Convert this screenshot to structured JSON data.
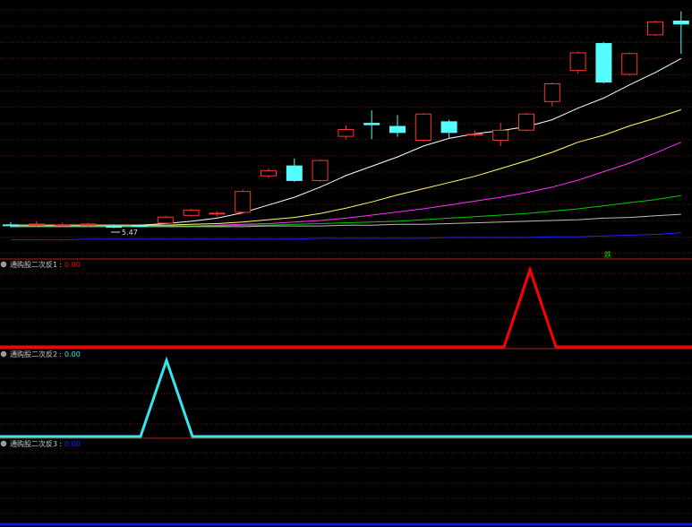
{
  "chart_data": [
    {
      "type": "candlestick",
      "panel": "main",
      "price_label": "5.47",
      "marker_text": "跌",
      "candles": [
        {
          "o": 5.47,
          "c": 5.45,
          "h": 5.5,
          "l": 5.43
        },
        {
          "o": 5.46,
          "c": 5.48,
          "h": 5.51,
          "l": 5.44
        },
        {
          "o": 5.46,
          "c": 5.47,
          "h": 5.49,
          "l": 5.44
        },
        {
          "o": 5.46,
          "c": 5.48,
          "h": 5.49,
          "l": 5.44
        },
        {
          "o": 5.45,
          "c": 5.44,
          "h": 5.47,
          "l": 5.42
        },
        {
          "o": 5.46,
          "c": 5.45,
          "h": 5.47,
          "l": 5.43
        },
        {
          "o": 5.48,
          "c": 5.57,
          "h": 5.58,
          "l": 5.46
        },
        {
          "o": 5.58,
          "c": 5.66,
          "h": 5.67,
          "l": 5.57
        },
        {
          "o": 5.6,
          "c": 5.62,
          "h": 5.64,
          "l": 5.57
        },
        {
          "o": 5.62,
          "c": 5.9,
          "h": 5.92,
          "l": 5.61
        },
        {
          "o": 6.09,
          "c": 6.17,
          "h": 6.19,
          "l": 6.07
        },
        {
          "o": 6.23,
          "c": 6.03,
          "h": 6.32,
          "l": 6.02
        },
        {
          "o": 6.03,
          "c": 6.3,
          "h": 6.31,
          "l": 6.02
        },
        {
          "o": 6.6,
          "c": 6.7,
          "h": 6.75,
          "l": 6.57
        },
        {
          "o": 6.78,
          "c": 6.75,
          "h": 6.94,
          "l": 6.57
        },
        {
          "o": 6.74,
          "c": 6.65,
          "h": 6.88,
          "l": 6.6
        },
        {
          "o": 6.55,
          "c": 6.9,
          "h": 6.91,
          "l": 6.54
        },
        {
          "o": 6.8,
          "c": 6.65,
          "h": 6.82,
          "l": 6.58
        },
        {
          "o": 6.63,
          "c": 6.64,
          "h": 6.68,
          "l": 6.6
        },
        {
          "o": 6.55,
          "c": 6.69,
          "h": 6.78,
          "l": 6.48
        },
        {
          "o": 6.68,
          "c": 6.9,
          "h": 6.91,
          "l": 6.67
        },
        {
          "o": 7.05,
          "c": 7.29,
          "h": 7.3,
          "l": 6.99
        },
        {
          "o": 7.45,
          "c": 7.69,
          "h": 7.7,
          "l": 7.42
        },
        {
          "o": 7.81,
          "c": 7.3,
          "h": 7.82,
          "l": 7.29
        },
        {
          "o": 7.4,
          "c": 7.68,
          "h": 7.69,
          "l": 7.39
        },
        {
          "o": 7.91,
          "c": 8.09,
          "h": 8.1,
          "l": 7.9
        },
        {
          "o": 8.1,
          "c": 8.05,
          "h": 8.22,
          "l": 7.67
        }
      ],
      "moving_averages": [
        {
          "color": "#ffffff",
          "values": [
            5.46,
            5.46,
            5.46,
            5.46,
            5.46,
            5.46,
            5.48,
            5.51,
            5.55,
            5.62,
            5.72,
            5.82,
            5.95,
            6.1,
            6.22,
            6.34,
            6.48,
            6.58,
            6.64,
            6.68,
            6.73,
            6.82,
            6.97,
            7.1,
            7.27,
            7.43,
            7.61
          ]
        },
        {
          "color": "#ffff66",
          "values": [
            5.46,
            5.46,
            5.46,
            5.46,
            5.46,
            5.46,
            5.46,
            5.47,
            5.48,
            5.5,
            5.53,
            5.56,
            5.61,
            5.68,
            5.76,
            5.85,
            5.93,
            6.01,
            6.09,
            6.19,
            6.29,
            6.4,
            6.53,
            6.62,
            6.74,
            6.84,
            6.95
          ]
        },
        {
          "color": "#ff33ff",
          "values": [
            5.45,
            5.45,
            5.45,
            5.45,
            5.45,
            5.45,
            5.45,
            5.45,
            5.46,
            5.47,
            5.48,
            5.5,
            5.52,
            5.55,
            5.59,
            5.63,
            5.67,
            5.72,
            5.77,
            5.82,
            5.88,
            5.95,
            6.04,
            6.15,
            6.26,
            6.39,
            6.53
          ]
        },
        {
          "color": "#00cc00",
          "values": [
            5.45,
            5.45,
            5.45,
            5.45,
            5.45,
            5.45,
            5.45,
            5.45,
            5.45,
            5.46,
            5.46,
            5.47,
            5.48,
            5.49,
            5.5,
            5.51,
            5.53,
            5.55,
            5.57,
            5.59,
            5.61,
            5.64,
            5.67,
            5.71,
            5.75,
            5.79,
            5.84
          ]
        },
        {
          "color": "#bbbbbb",
          "values": [
            5.44,
            5.44,
            5.44,
            5.44,
            5.44,
            5.44,
            5.44,
            5.44,
            5.44,
            5.44,
            5.45,
            5.45,
            5.45,
            5.46,
            5.46,
            5.47,
            5.47,
            5.48,
            5.49,
            5.5,
            5.51,
            5.52,
            5.53,
            5.55,
            5.56,
            5.58,
            5.6
          ]
        },
        {
          "color": "#2222ff",
          "values": [
            5.27,
            5.27,
            5.27,
            5.28,
            5.28,
            5.28,
            5.28,
            5.28,
            5.28,
            5.28,
            5.28,
            5.28,
            5.29,
            5.29,
            5.29,
            5.29,
            5.29,
            5.3,
            5.3,
            5.3,
            5.3,
            5.31,
            5.31,
            5.32,
            5.33,
            5.34,
            5.36
          ]
        }
      ],
      "colors": {
        "up": "#ff3333",
        "down": "#54fcfc"
      }
    },
    {
      "type": "line",
      "panel": "sub1",
      "title": "通购股二次反1",
      "value_text": "0.00",
      "color": "#ff0000",
      "value_color": "#ff0000",
      "x": [
        0,
        563,
        592,
        621,
        773
      ],
      "y": [
        0,
        0,
        1,
        0,
        0
      ]
    },
    {
      "type": "line",
      "panel": "sub2",
      "title": "通购股二次反2",
      "value_text": "0.00",
      "color": "#33e6f0",
      "value_color": "#33e6f0",
      "x": [
        0,
        157,
        186,
        215,
        773
      ],
      "y": [
        0,
        0,
        1,
        0,
        0
      ]
    },
    {
      "type": "line",
      "panel": "sub3",
      "title": "通购股二次反3",
      "value_text": "0.00",
      "color": "#1111ee",
      "value_color": "#2222ff",
      "x": [
        0,
        773
      ],
      "y": [
        0,
        0
      ]
    }
  ]
}
